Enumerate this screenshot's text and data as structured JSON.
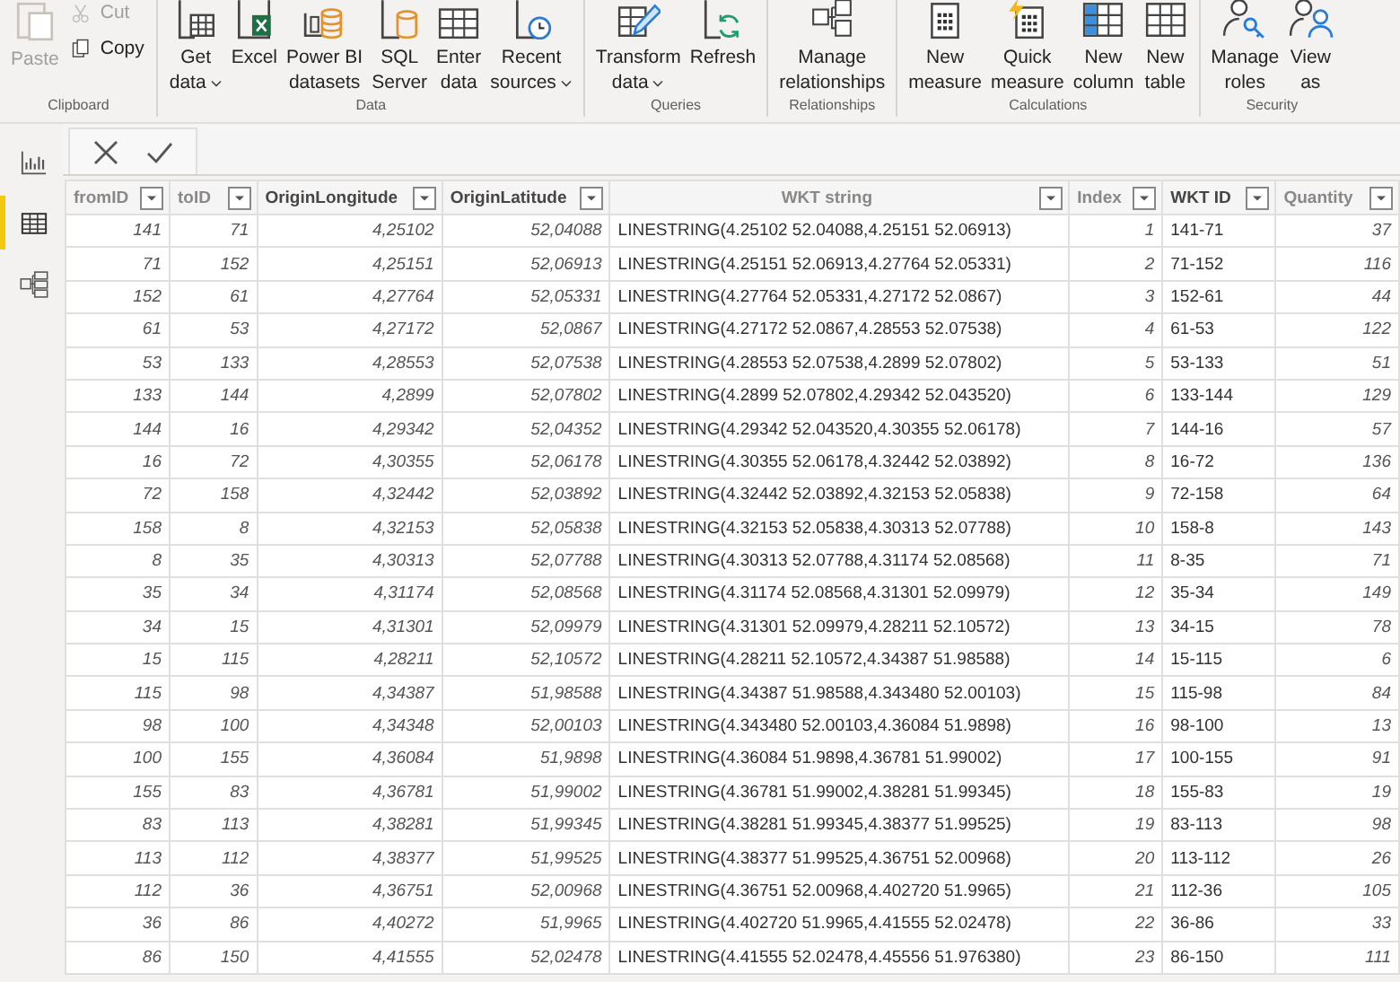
{
  "ribbon": {
    "groups": [
      {
        "label": "Clipboard",
        "buttons": [
          {
            "kind": "large",
            "lines": [
              "Paste"
            ],
            "disabled": true,
            "dropdown": false
          },
          {
            "kind": "small",
            "lines": [
              "Cut"
            ],
            "disabled": true
          },
          {
            "kind": "small",
            "lines": [
              "Copy"
            ],
            "disabled": false
          }
        ]
      },
      {
        "label": "Data",
        "buttons": [
          {
            "kind": "large",
            "lines": [
              "Get",
              "data"
            ],
            "disabled": false,
            "dropdown": true
          },
          {
            "kind": "large",
            "lines": [
              "Excel"
            ],
            "disabled": false,
            "dropdown": false
          },
          {
            "kind": "large",
            "lines": [
              "Power BI",
              "datasets"
            ],
            "disabled": false,
            "dropdown": false
          },
          {
            "kind": "large",
            "lines": [
              "SQL",
              "Server"
            ],
            "disabled": false,
            "dropdown": false
          },
          {
            "kind": "large",
            "lines": [
              "Enter",
              "data"
            ],
            "disabled": false,
            "dropdown": false
          },
          {
            "kind": "large",
            "lines": [
              "Recent",
              "sources"
            ],
            "disabled": false,
            "dropdown": true
          }
        ]
      },
      {
        "label": "Queries",
        "buttons": [
          {
            "kind": "large",
            "lines": [
              "Transform",
              "data"
            ],
            "disabled": false,
            "dropdown": true
          },
          {
            "kind": "large",
            "lines": [
              "Refresh"
            ],
            "disabled": false,
            "dropdown": false
          }
        ]
      },
      {
        "label": "Relationships",
        "buttons": [
          {
            "kind": "large",
            "lines": [
              "Manage",
              "relationships"
            ],
            "disabled": false,
            "dropdown": false
          }
        ]
      },
      {
        "label": "Calculations",
        "buttons": [
          {
            "kind": "large",
            "lines": [
              "New",
              "measure"
            ],
            "disabled": false,
            "dropdown": false
          },
          {
            "kind": "large",
            "lines": [
              "Quick",
              "measure"
            ],
            "disabled": false,
            "dropdown": false
          },
          {
            "kind": "large",
            "lines": [
              "New",
              "column"
            ],
            "disabled": false,
            "dropdown": false
          },
          {
            "kind": "large",
            "lines": [
              "New",
              "table"
            ],
            "disabled": false,
            "dropdown": false
          }
        ]
      },
      {
        "label": "Security",
        "buttons": [
          {
            "kind": "large",
            "lines": [
              "Manage",
              "roles"
            ],
            "disabled": false,
            "dropdown": false
          },
          {
            "kind": "large",
            "lines": [
              "View",
              "as"
            ],
            "disabled": false,
            "dropdown": false
          }
        ]
      }
    ]
  },
  "sidebar": {
    "items": [
      {
        "selected": false
      },
      {
        "selected": true
      },
      {
        "selected": false
      }
    ]
  },
  "table": {
    "columns": [
      {
        "label": "fromID",
        "dimmed": true,
        "kind": "number"
      },
      {
        "label": "toID",
        "dimmed": true,
        "kind": "number"
      },
      {
        "label": "OriginLongitude",
        "dimmed": false,
        "kind": "number"
      },
      {
        "label": "OriginLatitude",
        "dimmed": false,
        "kind": "number"
      },
      {
        "label": "WKT string",
        "dimmed": true,
        "kind": "text"
      },
      {
        "label": "Index",
        "dimmed": true,
        "kind": "number"
      },
      {
        "label": "WKT ID",
        "dimmed": false,
        "kind": "text"
      },
      {
        "label": "Quantity",
        "dimmed": true,
        "kind": "number"
      }
    ],
    "rows": [
      [
        "141",
        "71",
        "4,25102",
        "52,04088",
        "LINESTRING(4.25102 52.04088,4.25151 52.06913)",
        "1",
        "141-71",
        "37"
      ],
      [
        "71",
        "152",
        "4,25151",
        "52,06913",
        "LINESTRING(4.25151 52.06913,4.27764 52.05331)",
        "2",
        "71-152",
        "116"
      ],
      [
        "152",
        "61",
        "4,27764",
        "52,05331",
        "LINESTRING(4.27764 52.05331,4.27172 52.0867)",
        "3",
        "152-61",
        "44"
      ],
      [
        "61",
        "53",
        "4,27172",
        "52,0867",
        "LINESTRING(4.27172 52.0867,4.28553 52.07538)",
        "4",
        "61-53",
        "122"
      ],
      [
        "53",
        "133",
        "4,28553",
        "52,07538",
        "LINESTRING(4.28553 52.07538,4.2899 52.07802)",
        "5",
        "53-133",
        "51"
      ],
      [
        "133",
        "144",
        "4,2899",
        "52,07802",
        "LINESTRING(4.2899 52.07802,4.29342 52.043520)",
        "6",
        "133-144",
        "129"
      ],
      [
        "144",
        "16",
        "4,29342",
        "52,04352",
        "LINESTRING(4.29342 52.043520,4.30355 52.06178)",
        "7",
        "144-16",
        "57"
      ],
      [
        "16",
        "72",
        "4,30355",
        "52,06178",
        "LINESTRING(4.30355 52.06178,4.32442 52.03892)",
        "8",
        "16-72",
        "136"
      ],
      [
        "72",
        "158",
        "4,32442",
        "52,03892",
        "LINESTRING(4.32442 52.03892,4.32153 52.05838)",
        "9",
        "72-158",
        "64"
      ],
      [
        "158",
        "8",
        "4,32153",
        "52,05838",
        "LINESTRING(4.32153 52.05838,4.30313 52.07788)",
        "10",
        "158-8",
        "143"
      ],
      [
        "8",
        "35",
        "4,30313",
        "52,07788",
        "LINESTRING(4.30313 52.07788,4.31174 52.08568)",
        "11",
        "8-35",
        "71"
      ],
      [
        "35",
        "34",
        "4,31174",
        "52,08568",
        "LINESTRING(4.31174 52.08568,4.31301 52.09979)",
        "12",
        "35-34",
        "149"
      ],
      [
        "34",
        "15",
        "4,31301",
        "52,09979",
        "LINESTRING(4.31301 52.09979,4.28211 52.10572)",
        "13",
        "34-15",
        "78"
      ],
      [
        "15",
        "115",
        "4,28211",
        "52,10572",
        "LINESTRING(4.28211 52.10572,4.34387 51.98588)",
        "14",
        "15-115",
        "6"
      ],
      [
        "115",
        "98",
        "4,34387",
        "51,98588",
        "LINESTRING(4.34387 51.98588,4.343480 52.00103)",
        "15",
        "115-98",
        "84"
      ],
      [
        "98",
        "100",
        "4,34348",
        "52,00103",
        "LINESTRING(4.343480 52.00103,4.36084 51.9898)",
        "16",
        "98-100",
        "13"
      ],
      [
        "100",
        "155",
        "4,36084",
        "51,9898",
        "LINESTRING(4.36084 51.9898,4.36781 51.99002)",
        "17",
        "100-155",
        "91"
      ],
      [
        "155",
        "83",
        "4,36781",
        "51,99002",
        "LINESTRING(4.36781 51.99002,4.38281 51.99345)",
        "18",
        "155-83",
        "19"
      ],
      [
        "83",
        "113",
        "4,38281",
        "51,99345",
        "LINESTRING(4.38281 51.99345,4.38377 51.99525)",
        "19",
        "83-113",
        "98"
      ],
      [
        "113",
        "112",
        "4,38377",
        "51,99525",
        "LINESTRING(4.38377 51.99525,4.36751 52.00968)",
        "20",
        "113-112",
        "26"
      ],
      [
        "112",
        "36",
        "4,36751",
        "52,00968",
        "LINESTRING(4.36751 52.00968,4.402720 51.9965)",
        "21",
        "112-36",
        "105"
      ],
      [
        "36",
        "86",
        "4,40272",
        "51,9965",
        "LINESTRING(4.402720 51.9965,4.41555 52.02478)",
        "22",
        "36-86",
        "33"
      ],
      [
        "86",
        "150",
        "4,41555",
        "52,02478",
        "LINESTRING(4.41555 52.02478,4.45556 51.976380)",
        "23",
        "86-150",
        "111"
      ]
    ]
  }
}
